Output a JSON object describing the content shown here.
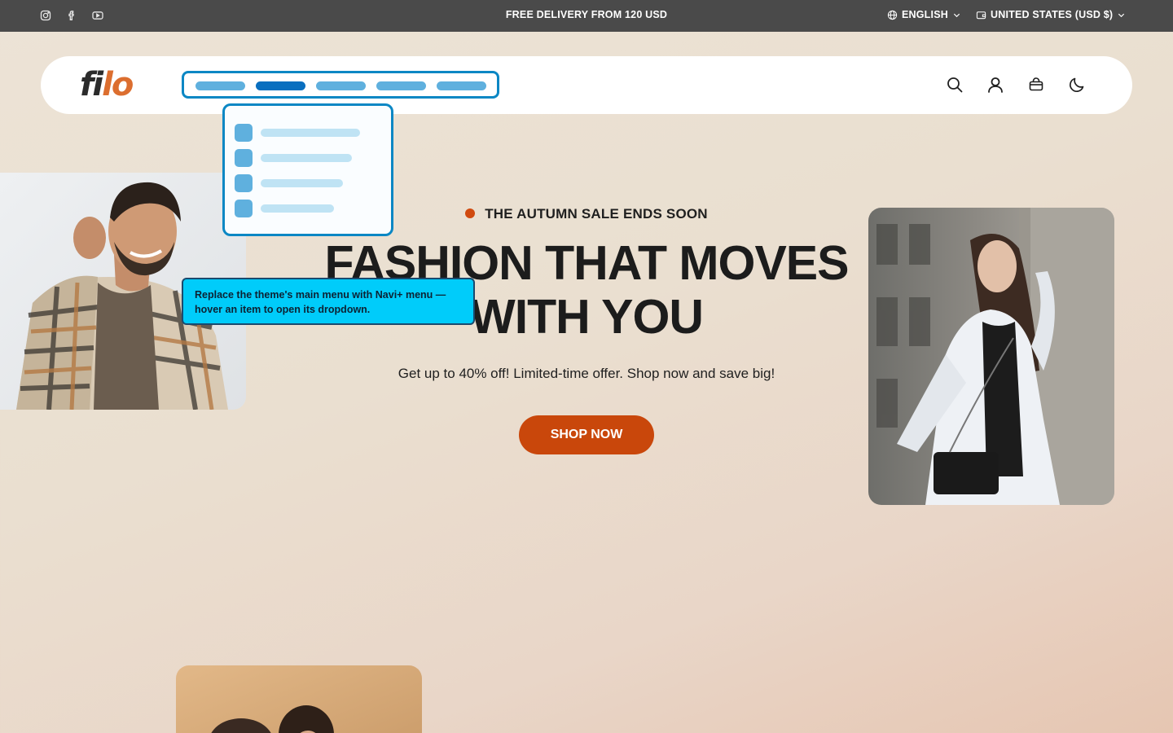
{
  "topbar": {
    "socials": [
      "instagram-icon",
      "facebook-icon",
      "youtube-icon"
    ],
    "announcement": "FREE DELIVERY FROM 120 USD",
    "language": "ENGLISH",
    "currency": "UNITED STATES (USD $)"
  },
  "header": {
    "logo_part1": "fi",
    "logo_part2": "lo",
    "nav_items_count": 5,
    "active_nav_index": 1,
    "icons": [
      "search-icon",
      "account-icon",
      "cart-icon",
      "dark-mode-icon"
    ]
  },
  "dropdown": {
    "items_count": 4
  },
  "tooltip": {
    "line1": "Replace the theme's main menu with Navi+ menu —",
    "line2": "hover an item to open its dropdown."
  },
  "hero": {
    "eyebrow": "THE AUTUMN SALE ENDS SOON",
    "title_line1": "FASHION THAT MOVES",
    "title_line2": "WITH YOU",
    "subtitle": "Get up to 40% off! Limited-time offer. Shop now and save big!",
    "cta": "SHOP NOW"
  },
  "colors": {
    "topbar_bg": "#4a4a4a",
    "accent": "#c9470b",
    "logo_accent": "#dc6e2f",
    "navi_border": "#0b87c4",
    "tooltip_bg": "#00ccfa"
  }
}
